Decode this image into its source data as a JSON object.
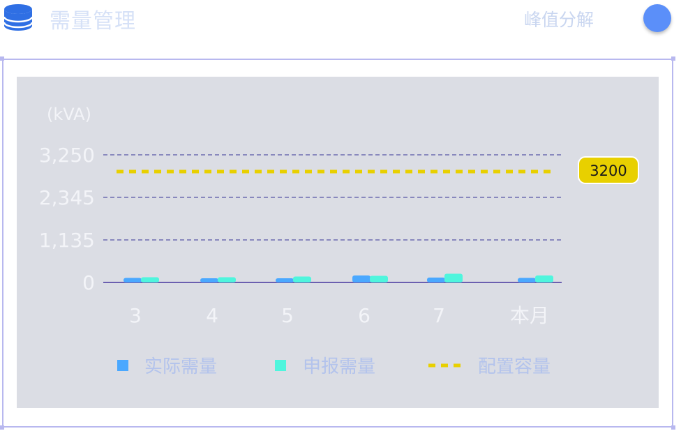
{
  "header": {
    "title": "需量管理",
    "peak_link": "峰值分解",
    "icon": "database-icon",
    "accent": "#2f6fe4"
  },
  "chart_data": {
    "type": "bar",
    "unit_label": "(kVA)",
    "categories": [
      "3",
      "4",
      "5",
      "6",
      "7",
      "本月"
    ],
    "y_ticks": [
      "3,250",
      "2,345",
      "1,135",
      "0"
    ],
    "series": [
      {
        "name": "实际需量",
        "values": [
          130,
          110,
          110,
          200,
          140,
          130
        ],
        "color": "#4aa8ff"
      },
      {
        "name": "申报需量",
        "values": [
          150,
          150,
          170,
          190,
          250,
          200
        ],
        "color": "#4ff5dd"
      }
    ],
    "reference_line": {
      "name": "配置容量",
      "value": 3200,
      "label": "3200",
      "color": "#e8d000"
    },
    "ylim": [
      0,
      3250
    ],
    "grid": true,
    "legend": "bottom"
  }
}
